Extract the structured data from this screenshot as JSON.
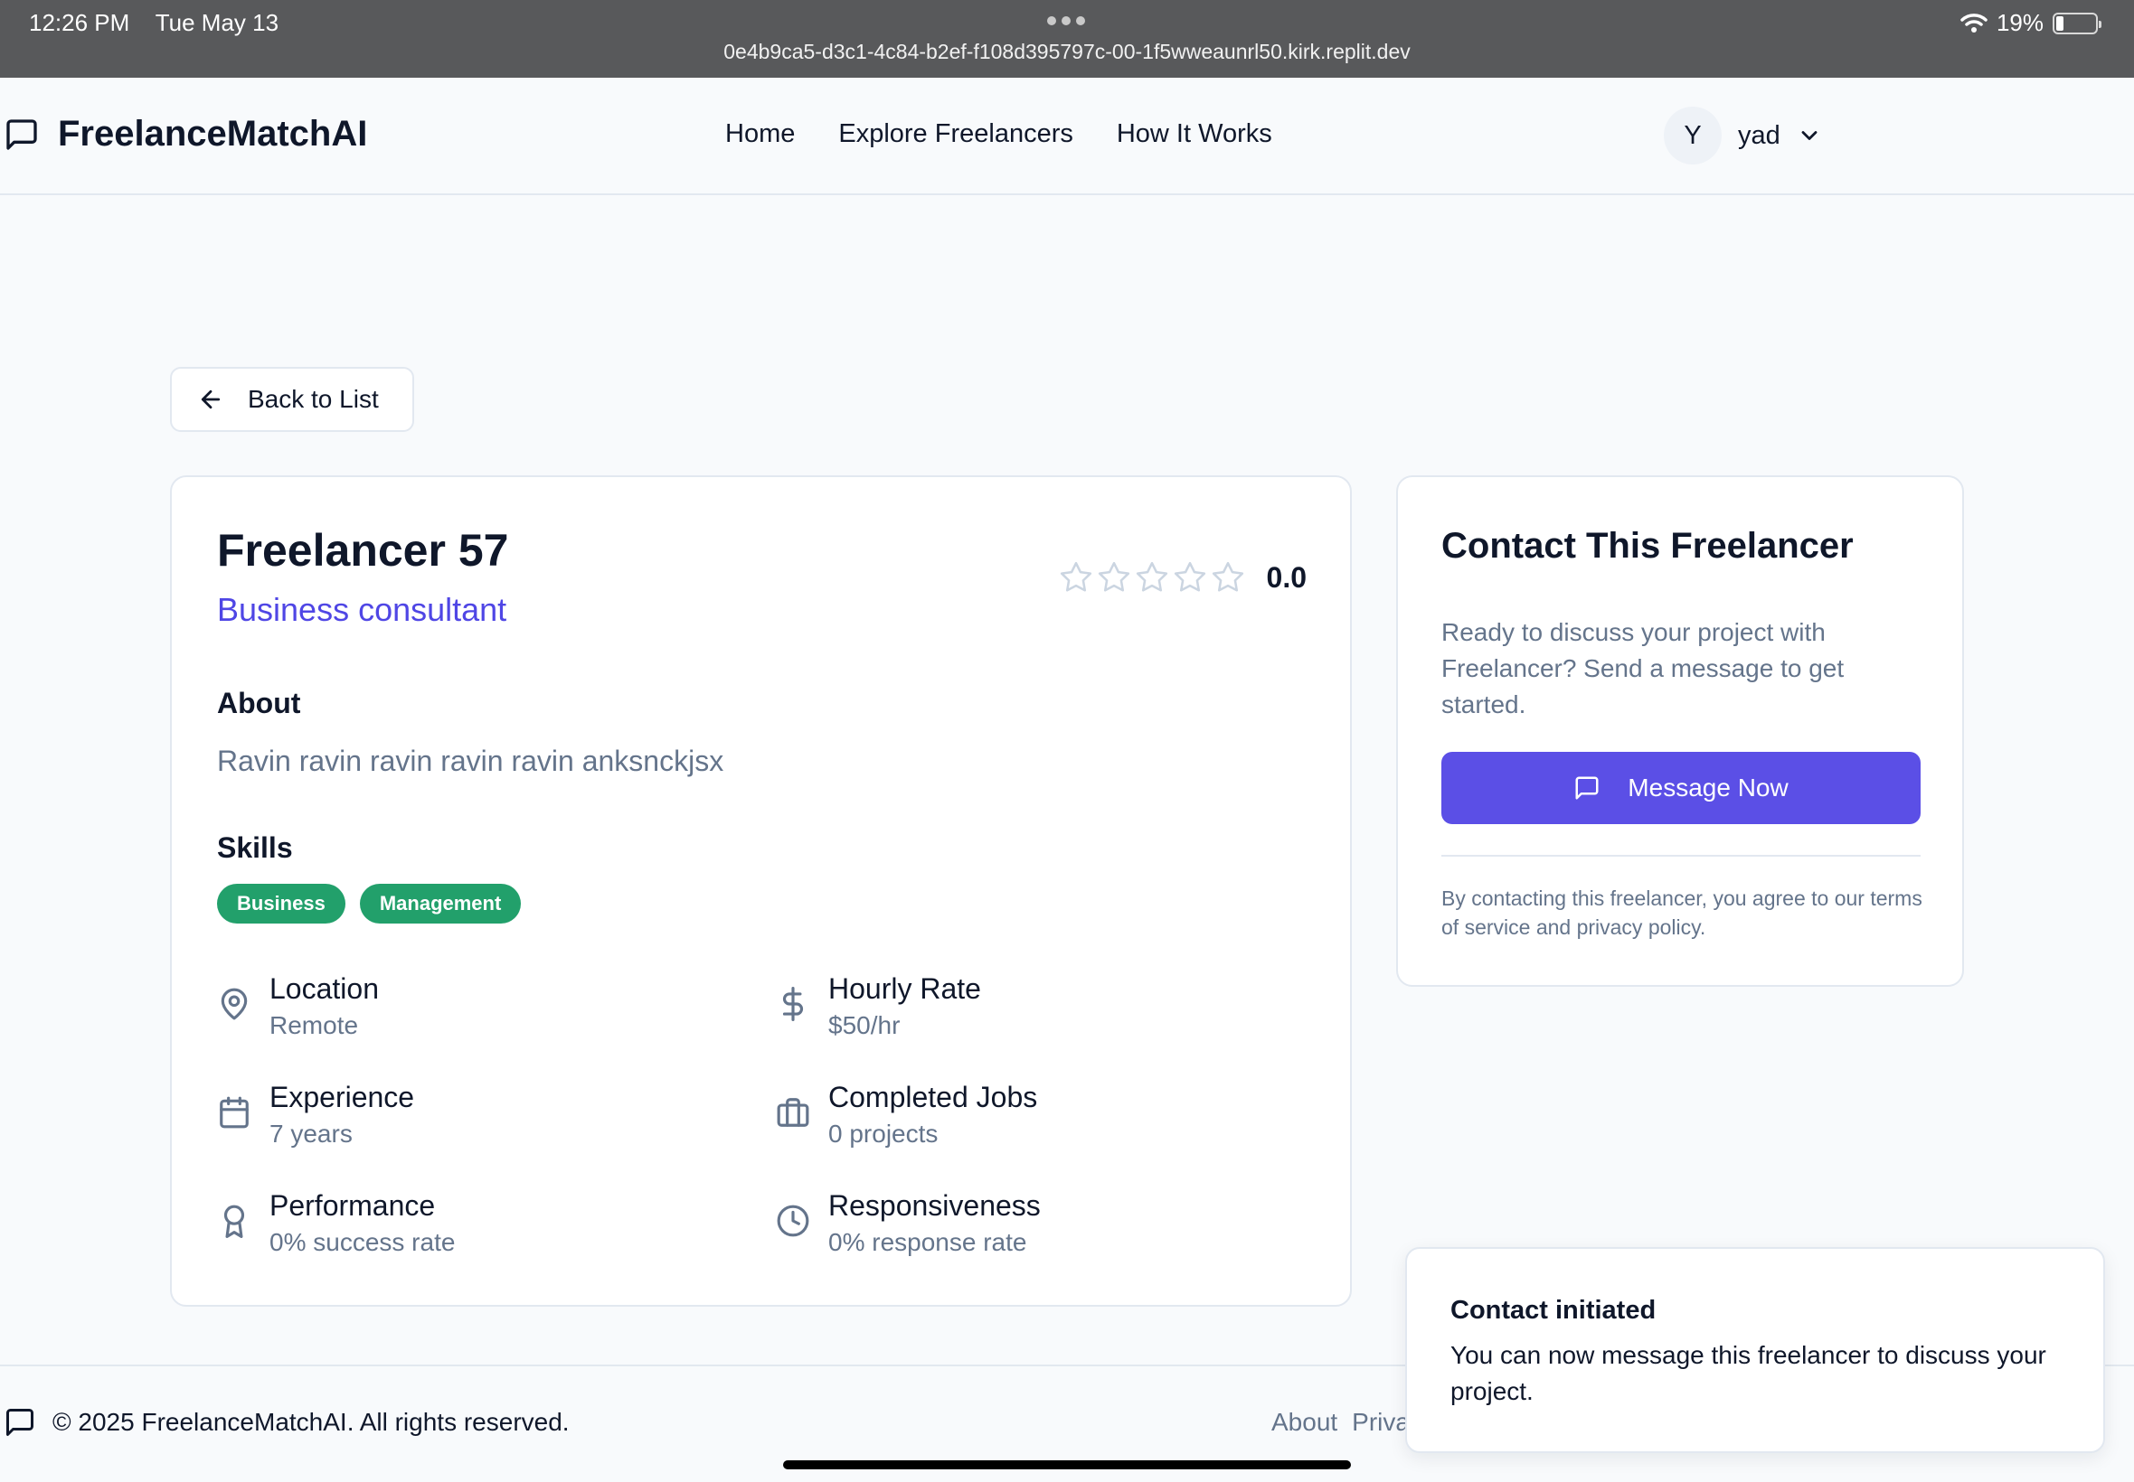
{
  "status_bar": {
    "time": "12:26 PM",
    "date": "Tue May 13",
    "url": "0e4b9ca5-d3c1-4c84-b2ef-f108d395797c-00-1f5wweaunrl50.kirk.replit.dev",
    "battery": "19%",
    "battery_level": 0.19
  },
  "header": {
    "brand": "FreelanceMatchAI",
    "nav": [
      "Home",
      "Explore Freelancers",
      "How It Works"
    ],
    "user": {
      "initial": "Y",
      "name": "yad"
    }
  },
  "back_button": "Back to List",
  "profile": {
    "name": "Freelancer 57",
    "title": "Business consultant",
    "rating": "0.0",
    "stars_filled": 0,
    "stars_total": 5,
    "about_heading": "About",
    "about_text": "Ravin ravin ravin ravin ravin anksnckjsx",
    "skills_heading": "Skills",
    "skills": [
      "Business",
      "Management"
    ],
    "stats": {
      "location": {
        "label": "Location",
        "value": "Remote"
      },
      "hourly_rate": {
        "label": "Hourly Rate",
        "value": "$50/hr"
      },
      "experience": {
        "label": "Experience",
        "value": "7 years"
      },
      "completed_jobs": {
        "label": "Completed Jobs",
        "value": "0 projects"
      },
      "performance": {
        "label": "Performance",
        "value": "0% success rate"
      },
      "responsiveness": {
        "label": "Responsiveness",
        "value": "0% response rate"
      }
    }
  },
  "contact": {
    "heading": "Contact This Freelancer",
    "text": "Ready to discuss your project with Freelancer? Send a message to get started.",
    "button": "Message Now",
    "terms": "By contacting this freelancer, you agree to our terms of service and privacy policy."
  },
  "footer": {
    "copyright": "© 2025 FreelanceMatchAI. All rights reserved.",
    "links": [
      "About",
      "Priva"
    ]
  },
  "toast": {
    "title": "Contact initiated",
    "message": "You can now message this freelancer to discuss your project."
  },
  "colors": {
    "accent": "#5b4fe6",
    "title_purple": "#4f46e5",
    "chip_green": "#22a06b",
    "muted_text": "#64748b",
    "status_bar": "#58595b"
  },
  "icons": [
    "message-square-icon",
    "arrow-left-icon",
    "star-icon",
    "map-pin-icon",
    "dollar-icon",
    "calendar-icon",
    "briefcase-icon",
    "award-icon",
    "clock-icon",
    "chevron-down-icon",
    "wifi-icon",
    "battery-icon"
  ]
}
